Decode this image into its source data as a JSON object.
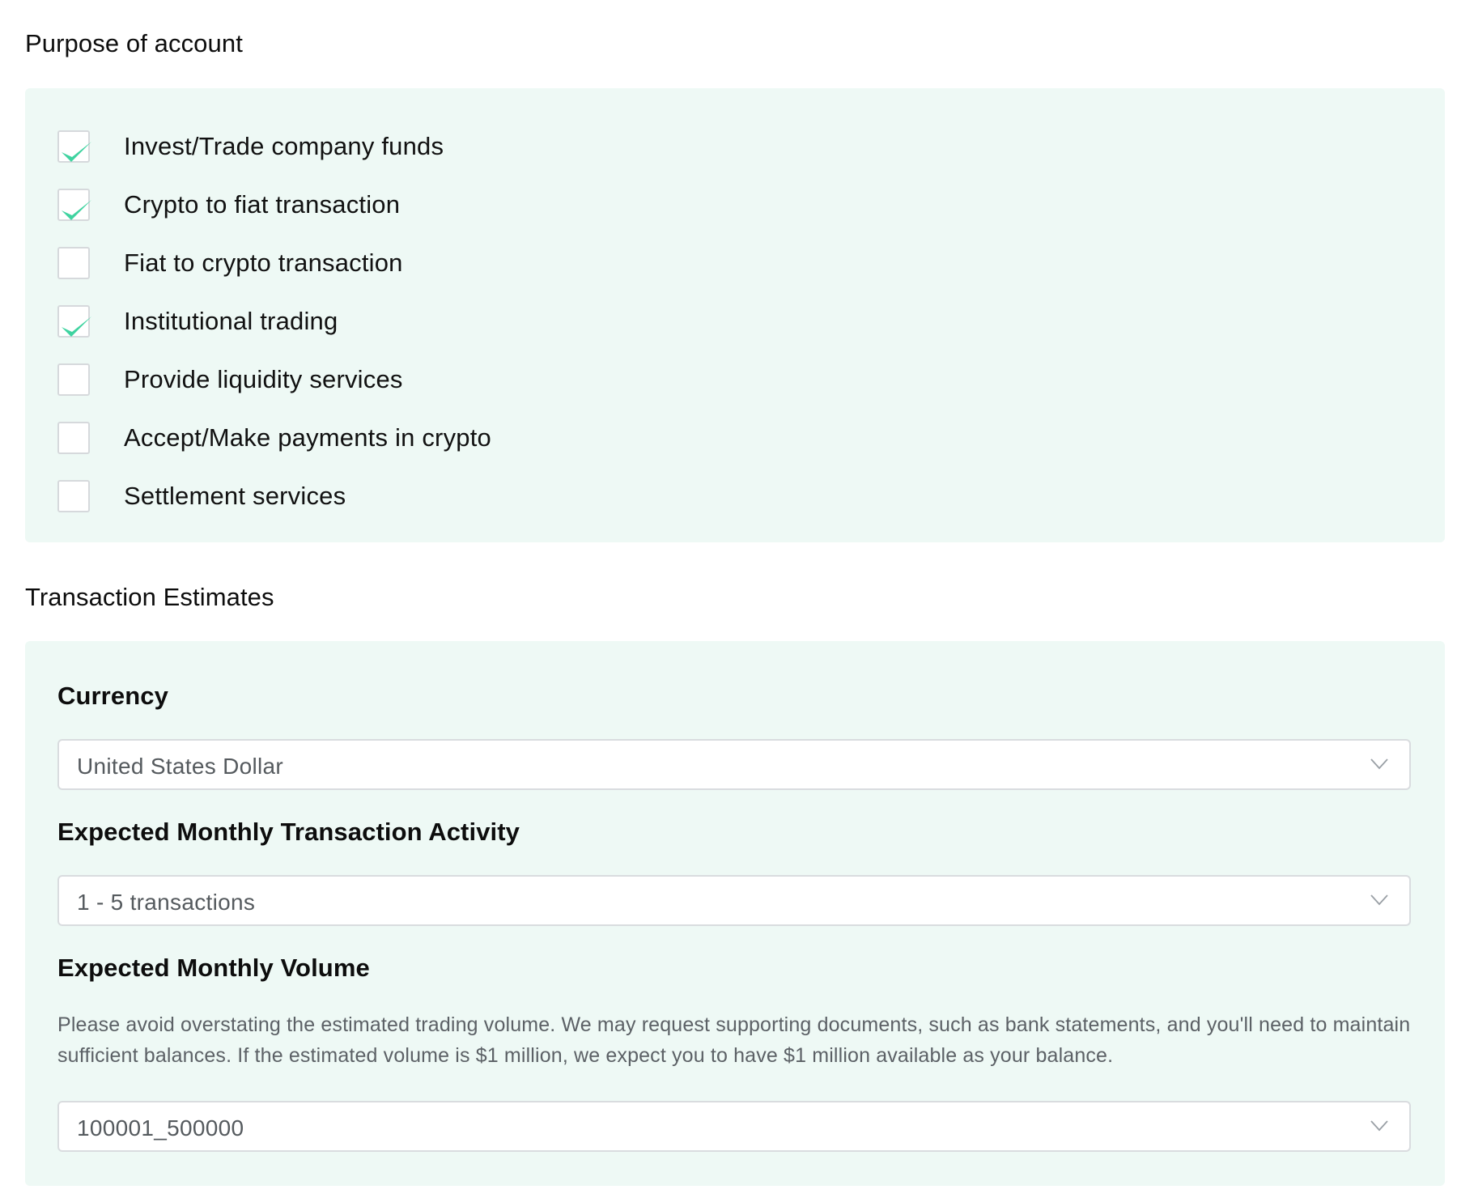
{
  "purpose": {
    "title": "Purpose of account",
    "options": [
      {
        "label": "Invest/Trade company funds",
        "checked": true
      },
      {
        "label": "Crypto to fiat transaction",
        "checked": true
      },
      {
        "label": "Fiat to crypto transaction",
        "checked": false
      },
      {
        "label": "Institutional trading",
        "checked": true
      },
      {
        "label": "Provide liquidity services",
        "checked": false
      },
      {
        "label": "Accept/Make payments in crypto",
        "checked": false
      },
      {
        "label": "Settlement services",
        "checked": false
      }
    ]
  },
  "estimates": {
    "title": "Transaction Estimates",
    "currency": {
      "label": "Currency",
      "value": "United States Dollar"
    },
    "activity": {
      "label": "Expected Monthly Transaction Activity",
      "value": "1 - 5 transactions"
    },
    "volume": {
      "label": "Expected Monthly Volume",
      "note": "Please avoid overstating the estimated trading volume. We may request supporting documents, such as bank statements, and you'll need to maintain sufficient balances. If the estimated volume is $1 million, we expect you to have $1 million available as your balance.",
      "value": "100001_500000"
    }
  },
  "icons": {
    "checkmark": "checkmark-icon",
    "dropdown": "chevron-down-icon"
  },
  "colors": {
    "panel_background": "#eef9f5",
    "checkmark": "#3fd3a0",
    "border": "#d9dcdf"
  }
}
